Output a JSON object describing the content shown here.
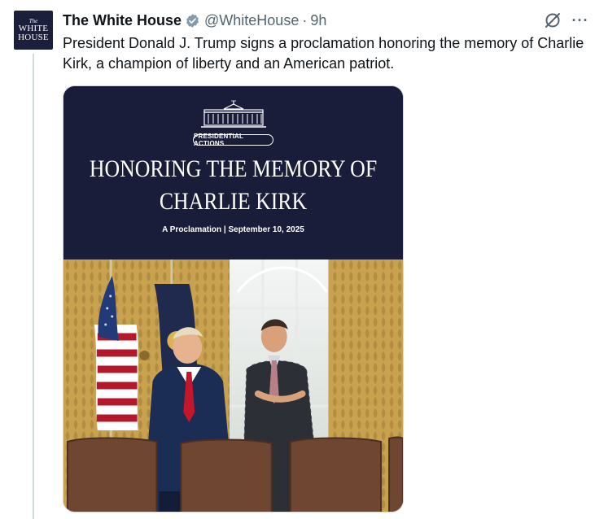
{
  "tweet": {
    "avatar": {
      "line1": "The",
      "line2": "WHITE",
      "line3": "HOUSE"
    },
    "display_name": "The White House",
    "handle": "@WhiteHouse",
    "separator": "·",
    "time": "9h",
    "text": "President Donald J. Trump signs a proclamation honoring the memory of Charlie Kirk, a champion of liberty and an American patriot.",
    "more_glyph": "···"
  },
  "media": {
    "badge": "PRESIDENTIAL ACTIONS",
    "headline_line1": "HONORING THE MEMORY OF",
    "headline_line2": "CHARLIE KIRK",
    "subline": "A Proclamation | September 10, 2025"
  },
  "colors": {
    "banner": "#1a1d3a",
    "verified": "#829aab",
    "text": "#0f1419",
    "muted": "#536471"
  },
  "icons": [
    "verified-badge-icon",
    "grok-icon",
    "more-options-icon",
    "white-house-building-icon"
  ]
}
